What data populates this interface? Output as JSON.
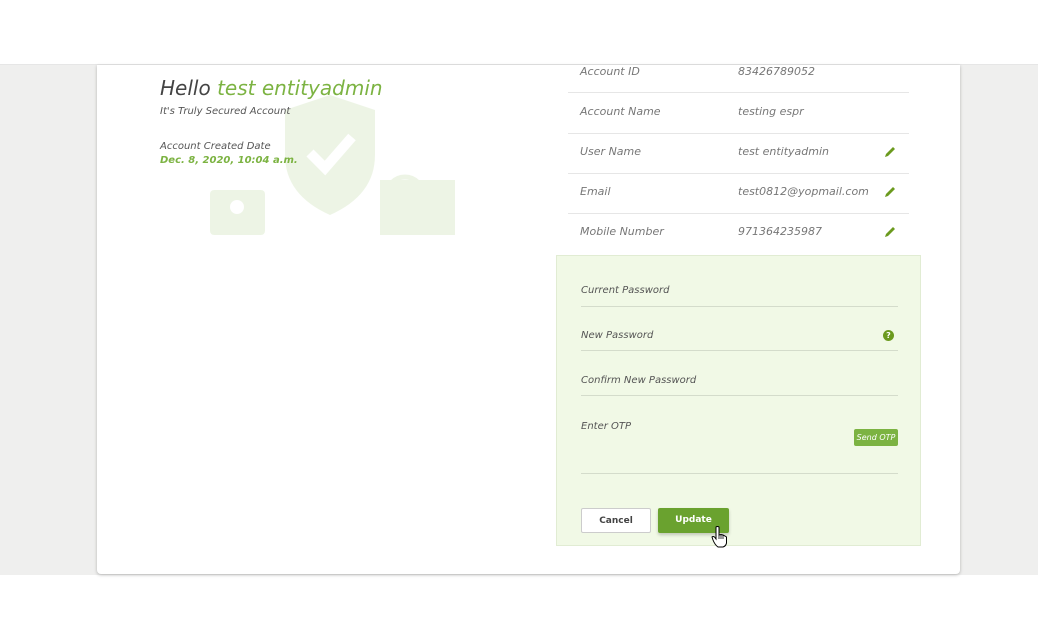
{
  "profile": {
    "greeting": "Hello",
    "username": "test entityadmin",
    "subtitle": "It's Truly Secured Account",
    "created_label": "Account Created Date",
    "created_value": "Dec. 8, 2020, 10:04 a.m."
  },
  "account_info": [
    {
      "label": "Account ID",
      "value": "83426789052",
      "editable": false
    },
    {
      "label": "Account Name",
      "value": "testing espr",
      "editable": false
    },
    {
      "label": "User Name",
      "value": "test entityadmin",
      "editable": true
    },
    {
      "label": "Email",
      "value": "test0812@yopmail.com",
      "editable": true
    },
    {
      "label": "Mobile Number",
      "value": "971364235987",
      "editable": true
    }
  ],
  "password_form": {
    "current_password": "Current Password",
    "new_password": "New Password",
    "confirm_password": "Confirm New Password",
    "otp": "Enter OTP",
    "send_otp": "Send OTP",
    "help_glyph": "?",
    "cancel": "Cancel",
    "update": "Update"
  },
  "colors": {
    "accent": "#7cb342",
    "panel_bg": "#f1f9e6",
    "button": "#6aa22f"
  }
}
